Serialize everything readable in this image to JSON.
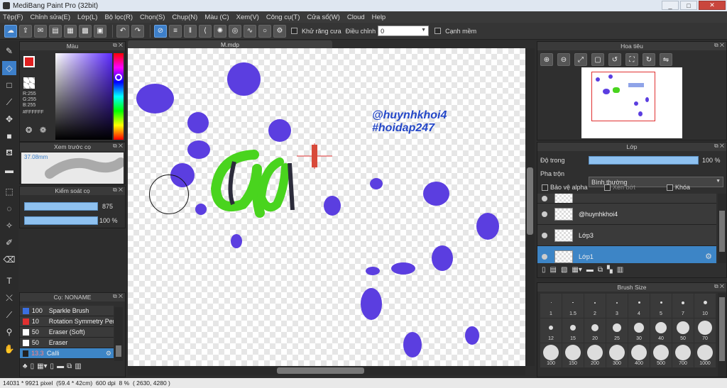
{
  "window": {
    "title": "MediBang Paint Pro (32bit)",
    "min": "_",
    "max": "□",
    "close": "✕"
  },
  "menu": [
    "Tệp(F)",
    "Chỉnh sửa(E)",
    "Lớp(L)",
    "Bộ lọc(R)",
    "Chọn(S)",
    "Chụp(N)",
    "Màu (C)",
    "Xem(V)",
    "Công cụ(T)",
    "Cửa sổ(W)",
    "Cloud",
    "Help"
  ],
  "toolbar": {
    "antialias_label": "Khử răng cưa",
    "correction_label": "Điều chỉnh",
    "correction_value": "0",
    "snap_label": "Cạnh mềm"
  },
  "color_panel": {
    "title": "Màu",
    "r": "R:255",
    "g": "G:255",
    "b": "B:255",
    "hex": "#FFFFFF",
    "fg": "#e02020",
    "bg": "#000000"
  },
  "brush_preview": {
    "title": "Xem trước cọ",
    "size": "37.08mm"
  },
  "brush_control": {
    "title": "Kiểm soát cọ",
    "size_value": "875",
    "opacity_value": "100 %"
  },
  "brush_list": {
    "title": "Cọ: NONAME",
    "items": [
      {
        "size": "100",
        "name": "Sparkle Brush",
        "color": "#3b6fe0"
      },
      {
        "size": "10",
        "name": "Rotation Symmetry Pen",
        "color": "#e03030"
      },
      {
        "size": "50",
        "name": "Eraser (Soft)",
        "color": "#ffffff"
      },
      {
        "size": "50",
        "name": "Eraser",
        "color": "#ffffff"
      },
      {
        "size": "13.3",
        "name": "Calli",
        "color": "#222222"
      }
    ]
  },
  "canvas": {
    "tab": "M.mdp",
    "watermark_line1": "@huynhkhoi4",
    "watermark_line2": "#hoidap247",
    "watermark_color": "#2447c8"
  },
  "navigator": {
    "title": "Hoa tiêu"
  },
  "layer_panel": {
    "title": "Lớp",
    "opacity_label": "Độ trong",
    "opacity_value": "100 %",
    "blend_label": "Pha trộn",
    "blend_value": "Bình thường",
    "protect_alpha": "Bảo vệ alpha",
    "clipping": "Xén bớt",
    "lock": "Khóa",
    "layers": [
      {
        "name": ""
      },
      {
        "name": "@huynhkhoi4"
      },
      {
        "name": "Lớp3"
      },
      {
        "name": "Lớp1"
      }
    ]
  },
  "brush_size": {
    "title": "Brush Size",
    "sizes": [
      "1",
      "1.5",
      "2",
      "3",
      "4",
      "5",
      "7",
      "10",
      "12",
      "15",
      "20",
      "25",
      "30",
      "40",
      "50",
      "70",
      "100",
      "150",
      "200",
      "300",
      "400",
      "500",
      "700",
      "1000"
    ]
  },
  "status": {
    "dimensions": "14031 * 9921 pixel",
    "physical": "(59.4 * 42cm)",
    "dpi": "600 dpi",
    "zoom": "8 %",
    "coords": "( 2630, 4280 )"
  }
}
